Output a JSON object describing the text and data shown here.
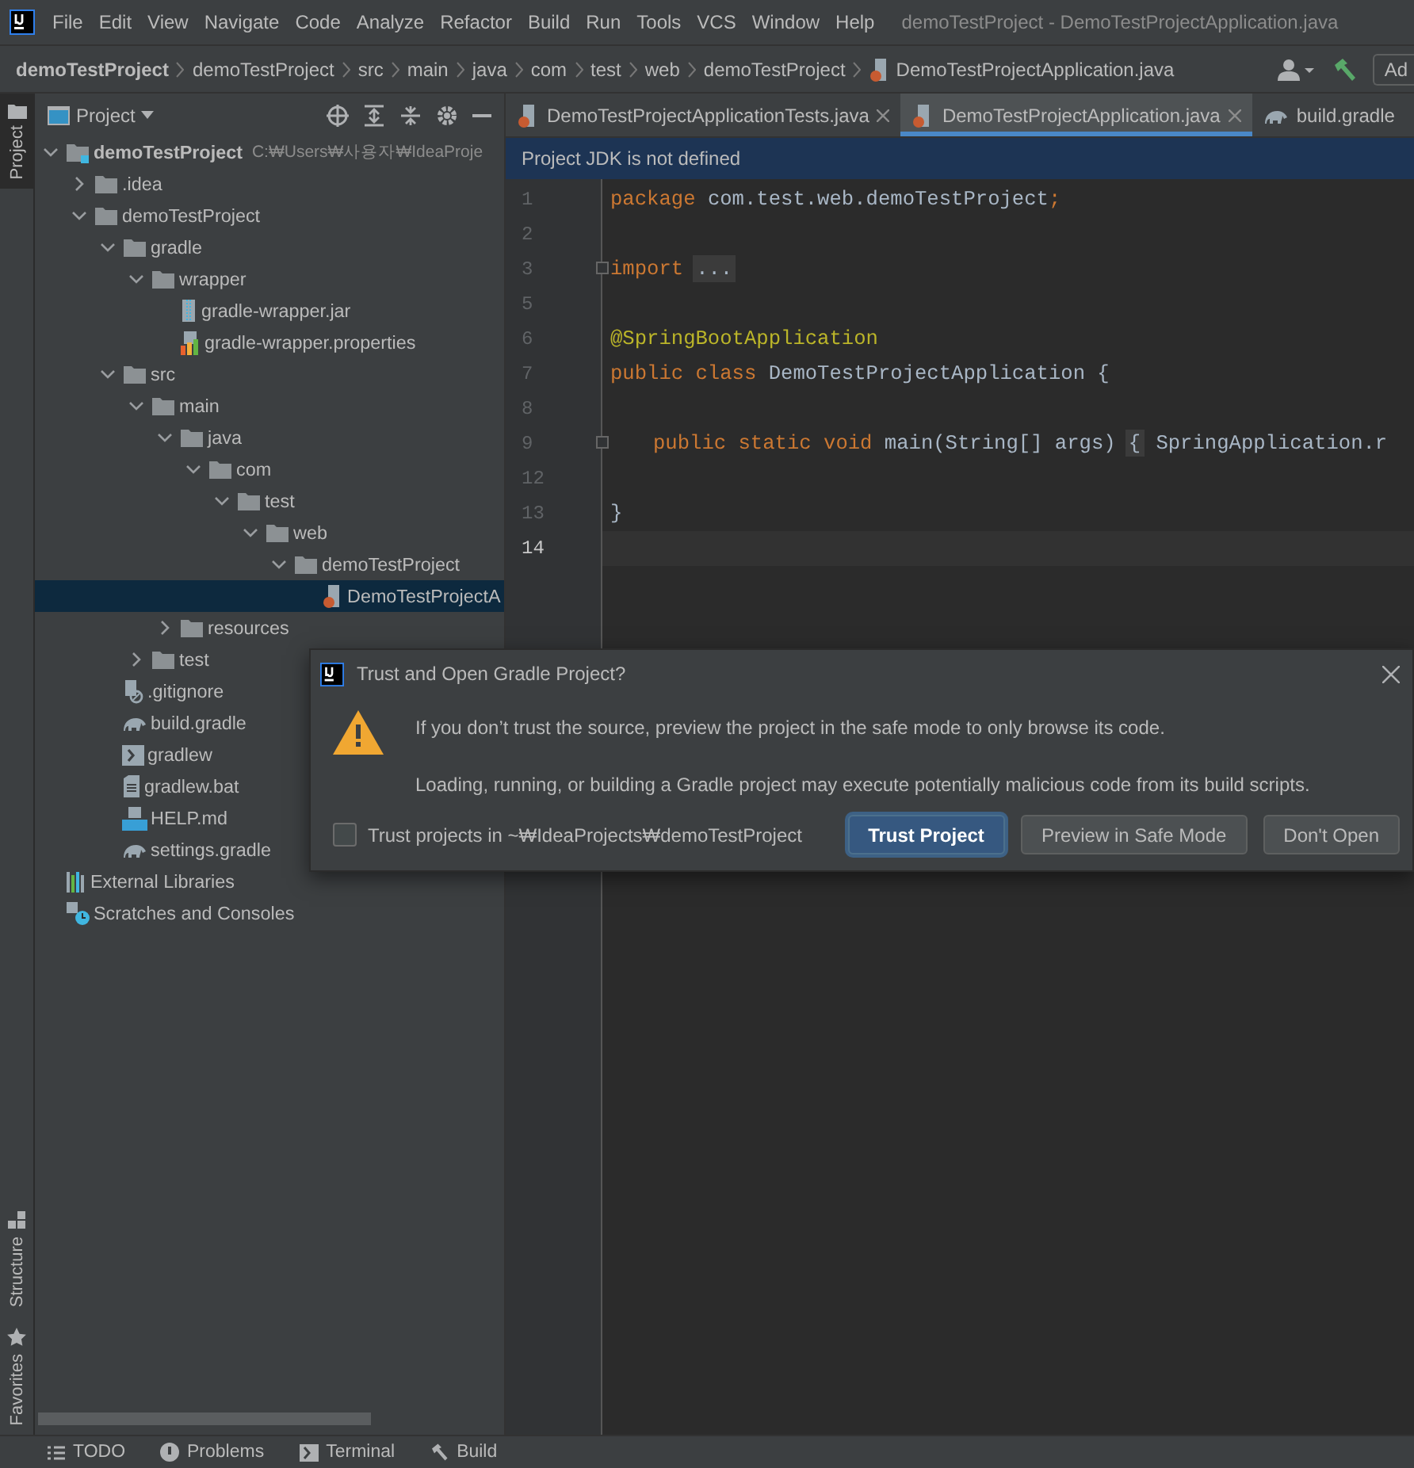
{
  "menu_bar": {
    "items": [
      "File",
      "Edit",
      "View",
      "Navigate",
      "Code",
      "Analyze",
      "Refactor",
      "Build",
      "Run",
      "Tools",
      "VCS",
      "Window",
      "Help"
    ],
    "window_title": "demoTestProject - DemoTestProjectApplication.java"
  },
  "breadcrumb": {
    "items": [
      {
        "label": "demoTestProject",
        "kind": "project"
      },
      {
        "label": "demoTestProject",
        "kind": "folder"
      },
      {
        "label": "src",
        "kind": "folder"
      },
      {
        "label": "main",
        "kind": "folder"
      },
      {
        "label": "java",
        "kind": "folder"
      },
      {
        "label": "com",
        "kind": "folder"
      },
      {
        "label": "test",
        "kind": "folder"
      },
      {
        "label": "web",
        "kind": "folder"
      },
      {
        "label": "demoTestProject",
        "kind": "folder"
      },
      {
        "label": "DemoTestProjectApplication.java",
        "kind": "java"
      }
    ],
    "run_config_button": "Ad"
  },
  "tool_stripe": {
    "top": [
      {
        "label": "Project",
        "selected": true
      }
    ],
    "bottom": [
      {
        "label": "Structure",
        "selected": false
      },
      {
        "label": "Favorites",
        "selected": false
      }
    ]
  },
  "project_panel": {
    "title": "Project",
    "tree": [
      {
        "label": "demoTestProject",
        "path": "C:₩Users₩사용자₩IdeaProje",
        "kind": "module",
        "expanded": true,
        "selected": false,
        "children": [
          {
            "label": ".idea",
            "kind": "folder",
            "expanded": false,
            "selected": false
          },
          {
            "label": "demoTestProject",
            "kind": "folder",
            "expanded": true,
            "selected": false,
            "children": [
              {
                "label": "gradle",
                "kind": "folder",
                "expanded": true,
                "selected": false,
                "children": [
                  {
                    "label": "wrapper",
                    "kind": "folder",
                    "expanded": true,
                    "selected": false,
                    "children": [
                      {
                        "label": "gradle-wrapper.jar",
                        "kind": "jar",
                        "selected": false
                      },
                      {
                        "label": "gradle-wrapper.properties",
                        "kind": "properties",
                        "selected": false
                      }
                    ]
                  }
                ]
              },
              {
                "label": "src",
                "kind": "folder",
                "expanded": true,
                "selected": false,
                "children": [
                  {
                    "label": "main",
                    "kind": "folder",
                    "expanded": true,
                    "selected": false,
                    "children": [
                      {
                        "label": "java",
                        "kind": "folder",
                        "expanded": true,
                        "selected": false,
                        "children": [
                          {
                            "label": "com",
                            "kind": "folder",
                            "expanded": true,
                            "selected": false,
                            "children": [
                              {
                                "label": "test",
                                "kind": "folder",
                                "expanded": true,
                                "selected": false,
                                "children": [
                                  {
                                    "label": "web",
                                    "kind": "folder",
                                    "expanded": true,
                                    "selected": false,
                                    "children": [
                                      {
                                        "label": "demoTestProject",
                                        "kind": "folder",
                                        "expanded": true,
                                        "selected": false,
                                        "children": [
                                          {
                                            "label": "DemoTestProjectA",
                                            "kind": "java",
                                            "selected": true
                                          }
                                        ]
                                      }
                                    ]
                                  }
                                ]
                              }
                            ]
                          }
                        ]
                      },
                      {
                        "label": "resources",
                        "kind": "folder",
                        "expanded": false,
                        "selected": false
                      }
                    ]
                  },
                  {
                    "label": "test",
                    "kind": "folder",
                    "expanded": false,
                    "selected": false
                  }
                ]
              },
              {
                "label": ".gitignore",
                "kind": "gitignore",
                "selected": false
              },
              {
                "label": "build.gradle",
                "kind": "gradle",
                "selected": false
              },
              {
                "label": "gradlew",
                "kind": "shell",
                "selected": false
              },
              {
                "label": "gradlew.bat",
                "kind": "text",
                "selected": false
              },
              {
                "label": "HELP.md",
                "kind": "markdown",
                "selected": false
              },
              {
                "label": "settings.gradle",
                "kind": "gradle",
                "selected": false
              }
            ]
          }
        ]
      },
      {
        "label": "External Libraries",
        "kind": "libraries",
        "selected": false
      },
      {
        "label": "Scratches and Consoles",
        "kind": "scratches",
        "selected": false
      }
    ]
  },
  "editor_tabs": [
    {
      "label": "DemoTestProjectApplicationTests.java",
      "kind": "java",
      "selected": false,
      "closable": true
    },
    {
      "label": "DemoTestProjectApplication.java",
      "kind": "java",
      "selected": true,
      "closable": true
    },
    {
      "label": "build.gradle",
      "kind": "gradle",
      "selected": false,
      "closable": false
    }
  ],
  "banner": "Project JDK is not defined",
  "editor": {
    "lines": [
      {
        "number": "1",
        "current": false,
        "fold": false,
        "tokens": [
          {
            "kind": "keyword",
            "text": "package"
          },
          {
            "kind": "plain",
            "text": " com.test.web.demoTestProject"
          },
          {
            "kind": "keyword",
            "text": ";"
          }
        ]
      },
      {
        "number": "2",
        "current": false,
        "fold": false
      },
      {
        "number": "3",
        "current": false,
        "fold": true,
        "tokens": [
          {
            "kind": "keyword",
            "text": "import"
          },
          {
            "kind": "folded",
            "text": "..."
          }
        ]
      },
      {
        "number": "5",
        "current": false,
        "fold": false
      },
      {
        "number": "6",
        "current": false,
        "fold": false,
        "tokens": [
          {
            "kind": "annotation",
            "text": "@SpringBootApplication"
          }
        ]
      },
      {
        "number": "7",
        "current": false,
        "fold": false,
        "tokens": [
          {
            "kind": "keyword",
            "text": "public class"
          },
          {
            "kind": "plain",
            "text": " DemoTestProjectApplication {"
          }
        ]
      },
      {
        "number": "8",
        "current": false,
        "fold": false
      },
      {
        "number": "9",
        "current": false,
        "fold": true,
        "indented": true,
        "tokens": [
          {
            "kind": "keyword",
            "text": "public static void"
          },
          {
            "kind": "plain",
            "text": " main(String[] args)"
          },
          {
            "kind": "folded",
            "text": "{"
          },
          {
            "kind": "plain",
            "text": " SpringApplication.r"
          }
        ]
      },
      {
        "number": "12",
        "current": false,
        "fold": false
      },
      {
        "number": "13",
        "current": false,
        "fold": false,
        "tokens": [
          {
            "kind": "plain",
            "text": "}"
          }
        ]
      },
      {
        "number": "14",
        "current": true,
        "fold": false
      }
    ]
  },
  "dialog": {
    "title": "Trust and Open Gradle Project?",
    "messages": [
      "If you don’t trust the source, preview the project in the safe mode to only browse its code.",
      "Loading, running, or building a Gradle project may execute potentially malicious code from its build scripts."
    ],
    "checkbox": {
      "label": "Trust projects in ~₩IdeaProjects₩demoTestProject",
      "checked": false
    },
    "buttons": [
      {
        "label": "Trust Project",
        "primary": true
      },
      {
        "label": "Preview in Safe Mode",
        "primary": false
      },
      {
        "label": "Don't Open",
        "primary": false
      }
    ]
  },
  "bottom_bar": [
    {
      "label": "TODO",
      "kind": "todo"
    },
    {
      "label": "Problems",
      "kind": "problems"
    },
    {
      "label": "Terminal",
      "kind": "terminal"
    },
    {
      "label": "Build",
      "kind": "build"
    }
  ]
}
